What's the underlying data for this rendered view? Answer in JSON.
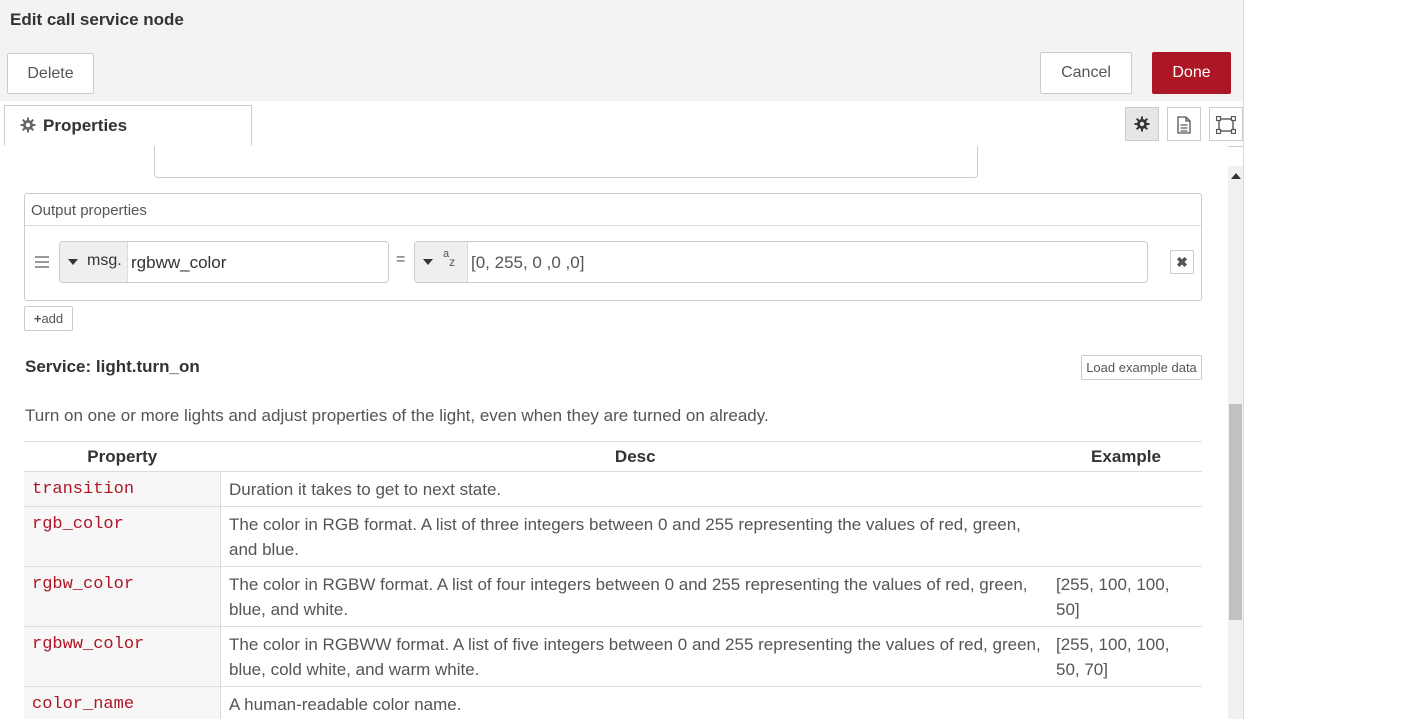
{
  "dialog": {
    "title": "Edit call service node"
  },
  "toolbar": {
    "delete_label": "Delete",
    "cancel_label": "Cancel",
    "done_label": "Done",
    "done_color": "#ad1625"
  },
  "tabs": {
    "properties_label": "Properties"
  },
  "output_properties": {
    "legend": "Output properties",
    "rows": [
      {
        "prefix": "msg.",
        "property": "rgbww_color",
        "operator": "=",
        "type_icon": "a-z string",
        "value": "[0, 255, 0 ,0 ,0]"
      }
    ],
    "add_label": "add"
  },
  "service": {
    "title": "Service: light.turn_on",
    "load_example_label": "Load example data",
    "description": "Turn on one or more lights and adjust properties of the light, even when they are turned on already.",
    "table": {
      "headers": [
        "Property",
        "Desc",
        "Example"
      ],
      "rows": [
        {
          "property": "transition",
          "desc": "Duration it takes to get to next state.",
          "example": ""
        },
        {
          "property": "rgb_color",
          "desc": "The color in RGB format. A list of three integers between 0 and 255 representing the values of red, green, and blue.",
          "example": ""
        },
        {
          "property": "rgbw_color",
          "desc": "The color in RGBW format. A list of four integers between 0 and 255 representing the values of red, green, blue, and white.",
          "example": "[255, 100, 100, 50]"
        },
        {
          "property": "rgbww_color",
          "desc": "The color in RGBWW format. A list of five integers between 0 and 255 representing the values of red, green, blue, cold white, and warm white.",
          "example": "[255, 100, 100, 50, 70]"
        },
        {
          "property": "color_name",
          "desc": "A human-readable color name.",
          "example": ""
        }
      ]
    }
  }
}
